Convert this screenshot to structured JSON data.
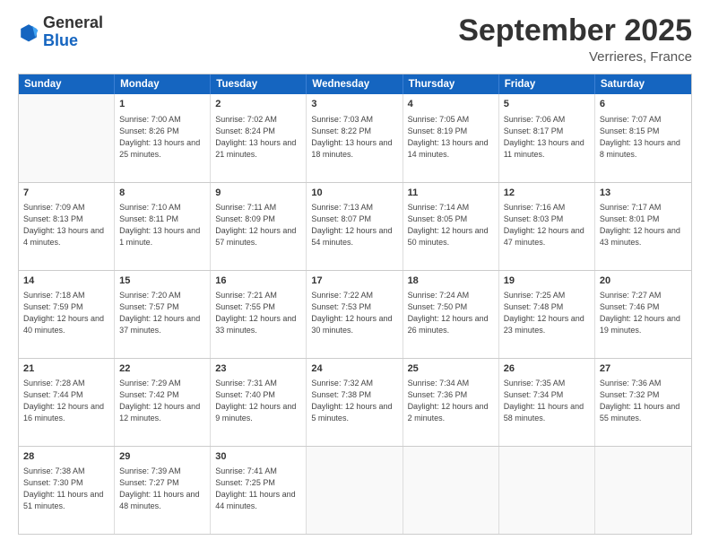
{
  "header": {
    "logo_general": "General",
    "logo_blue": "Blue",
    "month_title": "September 2025",
    "location": "Verrieres, France"
  },
  "weekdays": [
    "Sunday",
    "Monday",
    "Tuesday",
    "Wednesday",
    "Thursday",
    "Friday",
    "Saturday"
  ],
  "rows": [
    [
      {
        "day": "",
        "sunrise": "",
        "sunset": "",
        "daylight": "",
        "empty": true
      },
      {
        "day": "1",
        "sunrise": "Sunrise: 7:00 AM",
        "sunset": "Sunset: 8:26 PM",
        "daylight": "Daylight: 13 hours and 25 minutes."
      },
      {
        "day": "2",
        "sunrise": "Sunrise: 7:02 AM",
        "sunset": "Sunset: 8:24 PM",
        "daylight": "Daylight: 13 hours and 21 minutes."
      },
      {
        "day": "3",
        "sunrise": "Sunrise: 7:03 AM",
        "sunset": "Sunset: 8:22 PM",
        "daylight": "Daylight: 13 hours and 18 minutes."
      },
      {
        "day": "4",
        "sunrise": "Sunrise: 7:05 AM",
        "sunset": "Sunset: 8:19 PM",
        "daylight": "Daylight: 13 hours and 14 minutes."
      },
      {
        "day": "5",
        "sunrise": "Sunrise: 7:06 AM",
        "sunset": "Sunset: 8:17 PM",
        "daylight": "Daylight: 13 hours and 11 minutes."
      },
      {
        "day": "6",
        "sunrise": "Sunrise: 7:07 AM",
        "sunset": "Sunset: 8:15 PM",
        "daylight": "Daylight: 13 hours and 8 minutes."
      }
    ],
    [
      {
        "day": "7",
        "sunrise": "Sunrise: 7:09 AM",
        "sunset": "Sunset: 8:13 PM",
        "daylight": "Daylight: 13 hours and 4 minutes."
      },
      {
        "day": "8",
        "sunrise": "Sunrise: 7:10 AM",
        "sunset": "Sunset: 8:11 PM",
        "daylight": "Daylight: 13 hours and 1 minute."
      },
      {
        "day": "9",
        "sunrise": "Sunrise: 7:11 AM",
        "sunset": "Sunset: 8:09 PM",
        "daylight": "Daylight: 12 hours and 57 minutes."
      },
      {
        "day": "10",
        "sunrise": "Sunrise: 7:13 AM",
        "sunset": "Sunset: 8:07 PM",
        "daylight": "Daylight: 12 hours and 54 minutes."
      },
      {
        "day": "11",
        "sunrise": "Sunrise: 7:14 AM",
        "sunset": "Sunset: 8:05 PM",
        "daylight": "Daylight: 12 hours and 50 minutes."
      },
      {
        "day": "12",
        "sunrise": "Sunrise: 7:16 AM",
        "sunset": "Sunset: 8:03 PM",
        "daylight": "Daylight: 12 hours and 47 minutes."
      },
      {
        "day": "13",
        "sunrise": "Sunrise: 7:17 AM",
        "sunset": "Sunset: 8:01 PM",
        "daylight": "Daylight: 12 hours and 43 minutes."
      }
    ],
    [
      {
        "day": "14",
        "sunrise": "Sunrise: 7:18 AM",
        "sunset": "Sunset: 7:59 PM",
        "daylight": "Daylight: 12 hours and 40 minutes."
      },
      {
        "day": "15",
        "sunrise": "Sunrise: 7:20 AM",
        "sunset": "Sunset: 7:57 PM",
        "daylight": "Daylight: 12 hours and 37 minutes."
      },
      {
        "day": "16",
        "sunrise": "Sunrise: 7:21 AM",
        "sunset": "Sunset: 7:55 PM",
        "daylight": "Daylight: 12 hours and 33 minutes."
      },
      {
        "day": "17",
        "sunrise": "Sunrise: 7:22 AM",
        "sunset": "Sunset: 7:53 PM",
        "daylight": "Daylight: 12 hours and 30 minutes."
      },
      {
        "day": "18",
        "sunrise": "Sunrise: 7:24 AM",
        "sunset": "Sunset: 7:50 PM",
        "daylight": "Daylight: 12 hours and 26 minutes."
      },
      {
        "day": "19",
        "sunrise": "Sunrise: 7:25 AM",
        "sunset": "Sunset: 7:48 PM",
        "daylight": "Daylight: 12 hours and 23 minutes."
      },
      {
        "day": "20",
        "sunrise": "Sunrise: 7:27 AM",
        "sunset": "Sunset: 7:46 PM",
        "daylight": "Daylight: 12 hours and 19 minutes."
      }
    ],
    [
      {
        "day": "21",
        "sunrise": "Sunrise: 7:28 AM",
        "sunset": "Sunset: 7:44 PM",
        "daylight": "Daylight: 12 hours and 16 minutes."
      },
      {
        "day": "22",
        "sunrise": "Sunrise: 7:29 AM",
        "sunset": "Sunset: 7:42 PM",
        "daylight": "Daylight: 12 hours and 12 minutes."
      },
      {
        "day": "23",
        "sunrise": "Sunrise: 7:31 AM",
        "sunset": "Sunset: 7:40 PM",
        "daylight": "Daylight: 12 hours and 9 minutes."
      },
      {
        "day": "24",
        "sunrise": "Sunrise: 7:32 AM",
        "sunset": "Sunset: 7:38 PM",
        "daylight": "Daylight: 12 hours and 5 minutes."
      },
      {
        "day": "25",
        "sunrise": "Sunrise: 7:34 AM",
        "sunset": "Sunset: 7:36 PM",
        "daylight": "Daylight: 12 hours and 2 minutes."
      },
      {
        "day": "26",
        "sunrise": "Sunrise: 7:35 AM",
        "sunset": "Sunset: 7:34 PM",
        "daylight": "Daylight: 11 hours and 58 minutes."
      },
      {
        "day": "27",
        "sunrise": "Sunrise: 7:36 AM",
        "sunset": "Sunset: 7:32 PM",
        "daylight": "Daylight: 11 hours and 55 minutes."
      }
    ],
    [
      {
        "day": "28",
        "sunrise": "Sunrise: 7:38 AM",
        "sunset": "Sunset: 7:30 PM",
        "daylight": "Daylight: 11 hours and 51 minutes."
      },
      {
        "day": "29",
        "sunrise": "Sunrise: 7:39 AM",
        "sunset": "Sunset: 7:27 PM",
        "daylight": "Daylight: 11 hours and 48 minutes."
      },
      {
        "day": "30",
        "sunrise": "Sunrise: 7:41 AM",
        "sunset": "Sunset: 7:25 PM",
        "daylight": "Daylight: 11 hours and 44 minutes."
      },
      {
        "day": "",
        "sunrise": "",
        "sunset": "",
        "daylight": "",
        "empty": true
      },
      {
        "day": "",
        "sunrise": "",
        "sunset": "",
        "daylight": "",
        "empty": true
      },
      {
        "day": "",
        "sunrise": "",
        "sunset": "",
        "daylight": "",
        "empty": true
      },
      {
        "day": "",
        "sunrise": "",
        "sunset": "",
        "daylight": "",
        "empty": true
      }
    ]
  ]
}
